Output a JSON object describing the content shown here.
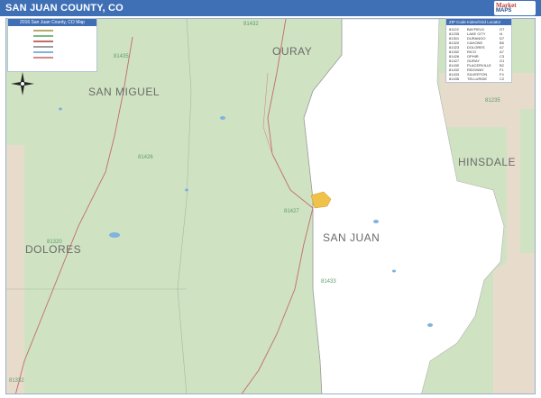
{
  "title": "SAN JUAN COUNTY, CO",
  "logo": {
    "line1": "Market",
    "line2": "MAPS"
  },
  "legend": {
    "header": "2016 San Juan County, CO Map"
  },
  "zip_table": {
    "header": "ZIP Code Index/Grid Locator",
    "rows": [
      {
        "zip": "81122",
        "name": "BAYFIELD",
        "grid": "G7"
      },
      {
        "zip": "81235",
        "name": "LAKE CITY",
        "grid": "I4"
      },
      {
        "zip": "81301",
        "name": "DURANGO",
        "grid": "D7"
      },
      {
        "zip": "81320",
        "name": "CAHONE",
        "grid": "B5"
      },
      {
        "zip": "81323",
        "name": "DOLORES",
        "grid": "A7"
      },
      {
        "zip": "81332",
        "name": "RICO",
        "grid": "A7"
      },
      {
        "zip": "81426",
        "name": "OPHIR",
        "grid": "C3"
      },
      {
        "zip": "81427",
        "name": "OURAY",
        "grid": "G1"
      },
      {
        "zip": "81430",
        "name": "PLACERVILLE",
        "grid": "B2"
      },
      {
        "zip": "81432",
        "name": "RIDGWAY",
        "grid": "F1"
      },
      {
        "zip": "81433",
        "name": "SILVERTON",
        "grid": "F4"
      },
      {
        "zip": "81435",
        "name": "TELLURIDE",
        "grid": "C2"
      }
    ]
  },
  "counties": {
    "ouray": "OURAY",
    "san_miguel": "SAN MIGUEL",
    "dolores": "DOLORES",
    "san_juan": "SAN JUAN",
    "hinsdale": "HINSDALE"
  },
  "zip_labels": {
    "z81432": "81432",
    "z81435": "81435",
    "z81427": "81427",
    "z81426": "81426",
    "z81235": "81235",
    "z81433": "81433",
    "z81320": "81320",
    "z81332": "81332"
  },
  "colors": {
    "title_bar": "#3f6fb5",
    "land": "#cfe3c2",
    "county": "#ffffff",
    "outside": "#e7dccb",
    "road": "#c46a6a",
    "water": "#7fb3e0",
    "city": "#f1c24a"
  }
}
